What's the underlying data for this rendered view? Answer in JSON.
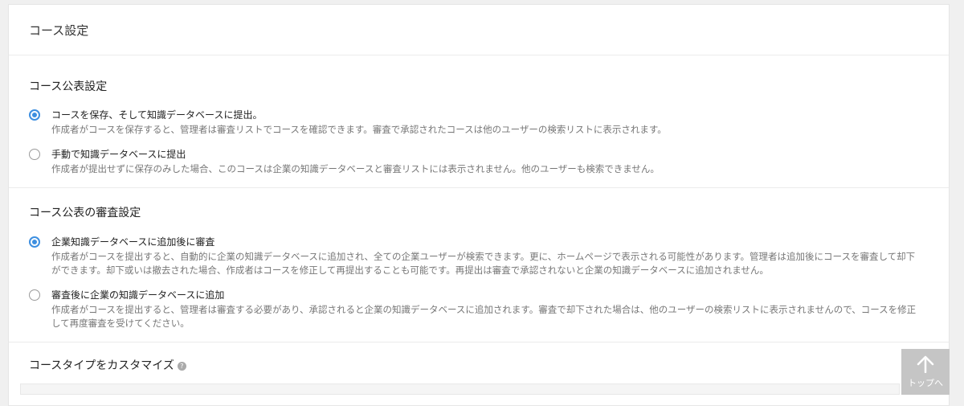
{
  "header": {
    "title": "コース設定"
  },
  "publish": {
    "title": "コース公表設定",
    "options": [
      {
        "label": "コースを保存、そして知識データベースに提出。",
        "desc": "作成者がコースを保存すると、管理者は審査リストでコースを確認できます。審査で承認されたコースは他のユーザーの検索リストに表示されます。",
        "checked": true
      },
      {
        "label": "手動で知識データベースに提出",
        "desc": "作成者が提出せずに保存のみした場合、このコースは企業の知識データベースと審査リストには表示されません。他のユーザーも検索できません。",
        "checked": false
      }
    ]
  },
  "review": {
    "title": "コース公表の審査設定",
    "options": [
      {
        "label": "企業知識データベースに追加後に審査",
        "desc": "作成者がコースを提出すると、自動的に企業の知識データベースに追加され、全ての企業ユーザーが検索できます。更に、ホームページで表示される可能性があります。管理者は追加後にコースを審査して却下ができます。却下或いは撤去された場合、作成者はコースを修正して再提出することも可能です。再提出は審査で承認されないと企業の知識データベースに追加されません。",
        "checked": true
      },
      {
        "label": "審査後に企業の知識データベースに追加",
        "desc": "作成者がコースを提出すると、管理者は審査する必要があり、承認されると企業の知識データベースに追加されます。審査で却下された場合は、他のユーザーの検索リストに表示されませんので、コースを修正して再度審査を受けてください。",
        "checked": false
      }
    ]
  },
  "customize": {
    "title": "コースタイプをカスタマイズ",
    "help_icon": "question-icon"
  },
  "back_to_top": {
    "label": "トップへ",
    "icon": "arrow-up-icon"
  },
  "colors": {
    "accent": "#3d8fe0",
    "background": "#f0f0f0",
    "muted_text": "#777777"
  }
}
